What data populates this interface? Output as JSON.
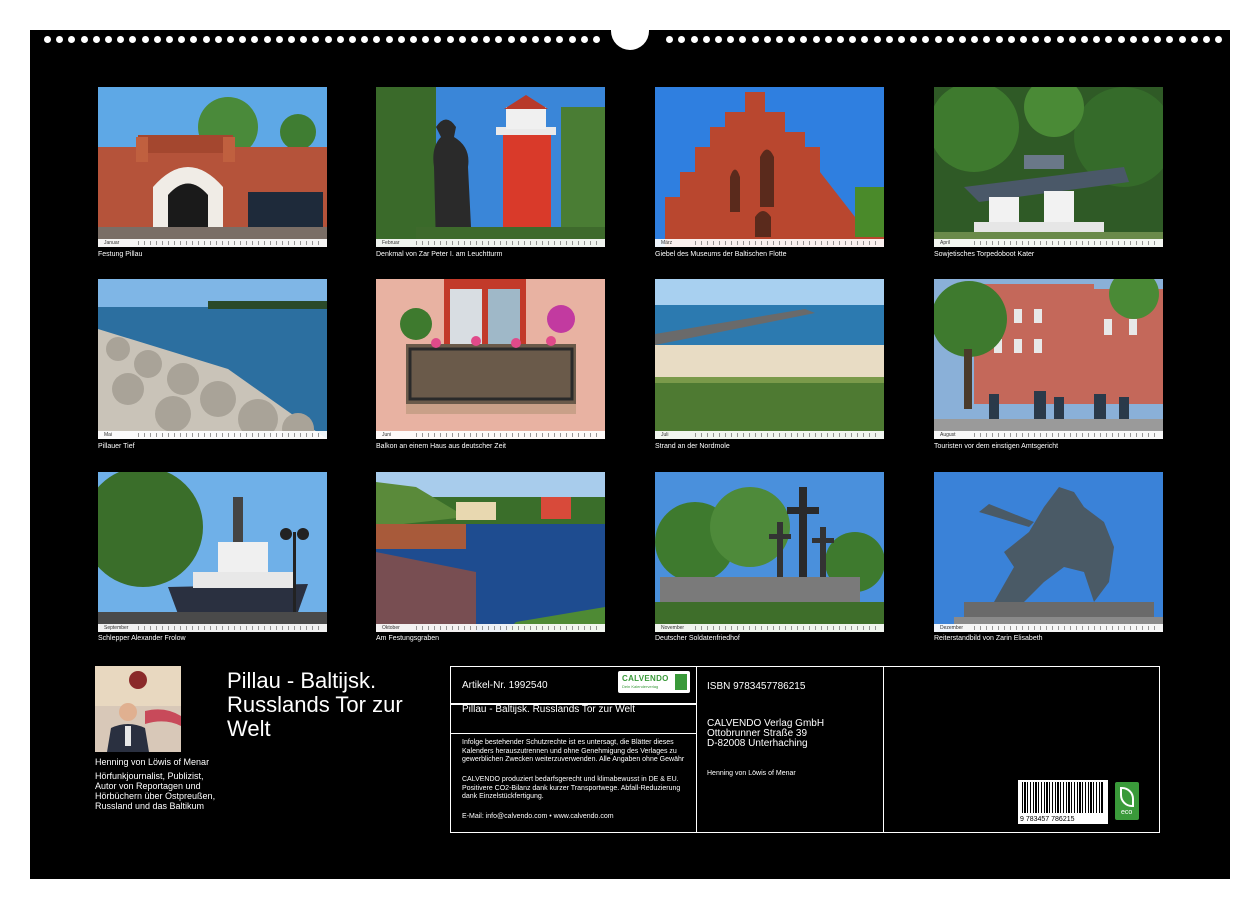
{
  "calendar": {
    "title": "Pillau - Baltijsk. Russlands Tor zur Welt",
    "months": [
      {
        "month": "Januar",
        "caption": "Festung Pillau"
      },
      {
        "month": "Februar",
        "caption": "Denkmal von Zar Peter I. am Leuchtturm"
      },
      {
        "month": "März",
        "caption": "Giebel des Museums der Baltischen Flotte"
      },
      {
        "month": "April",
        "caption": "Sowjetisches Torpedoboot Kater"
      },
      {
        "month": "Mai",
        "caption": "Pillauer Tief"
      },
      {
        "month": "Juni",
        "caption": "Balkon an einem Haus aus deutscher Zeit"
      },
      {
        "month": "Juli",
        "caption": "Strand an der Nordmole"
      },
      {
        "month": "August",
        "caption": "Touristen vor dem einstigen Amtsgericht"
      },
      {
        "month": "September",
        "caption": "Schlepper Alexander Frolow"
      },
      {
        "month": "Oktober",
        "caption": "Am Festungsgraben"
      },
      {
        "month": "November",
        "caption": "Deutscher Soldatenfriedhof"
      },
      {
        "month": "Dezember",
        "caption": "Reiterstandbild von Zarin Elisabeth"
      }
    ]
  },
  "author": {
    "name": "Henning von Löwis of Menar",
    "bio": "Hörfunkjournalist, Publizist, Autor von Reportagen und Hörbüchern über Ostpreußen, Russland und das Baltikum"
  },
  "info": {
    "article_no": "Artikel-Nr. 1992540",
    "logo_text": "CALVENDO",
    "logo_sub": "Dein Kalenderverlag",
    "title_line": "Pillau - Baltijsk. Russlands Tor zur Welt",
    "legal": "Infolge bestehender Schutzrechte ist es untersagt, die Blätter dieses Kalenders herauszutrennen und ohne Genehmigung des Verlages zu gewerblichen Zwecken weiterzuverwenden. Alle Angaben ohne Gewähr",
    "eco_note": "CALVENDO produziert bedarfsgerecht und klimabewusst in DE & EU. Positivere CO2-Bilanz dank kurzer Transportwege. Abfall-Reduzierung dank Einzelstückfertigung.",
    "contact": "E-Mail: info@calvendo.com • www.calvendo.com",
    "isbn": "ISBN 9783457786215",
    "publisher_name": "CALVENDO Verlag GmbH",
    "publisher_street": "Ottobrunner Straße 39",
    "publisher_city": "D-82008 Unterhaching",
    "author_credit": "Henning von Löwis of Menar",
    "barcode_number": "9 783457 786215",
    "eco_badge": "eco"
  }
}
